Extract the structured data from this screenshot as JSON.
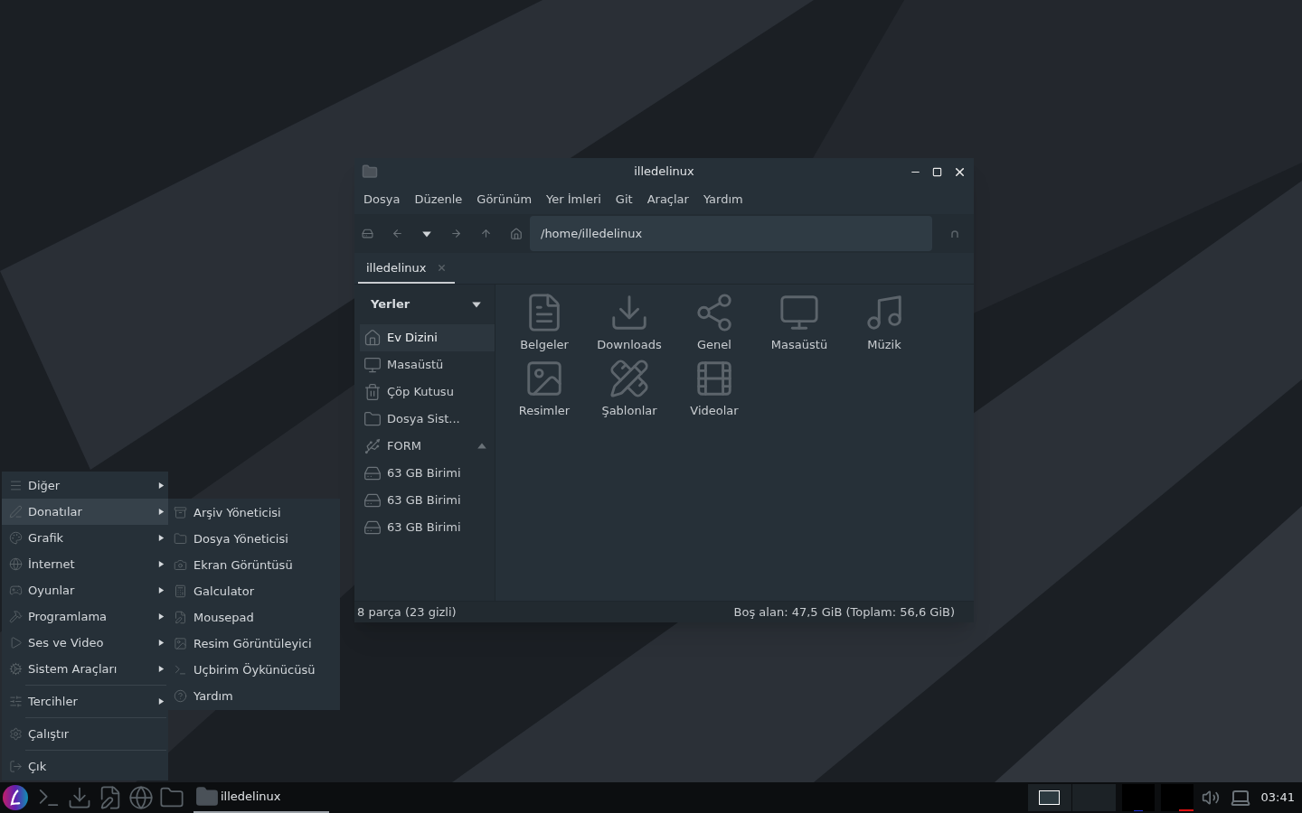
{
  "window": {
    "title": "illedelinux",
    "menu": [
      "Dosya",
      "Düzenle",
      "Görünüm",
      "Yer İmleri",
      "Git",
      "Araçlar",
      "Yardım"
    ],
    "path": "/home/illedelinux",
    "tabs": [
      {
        "label": "illedelinux",
        "selected": true
      }
    ],
    "sidebar": {
      "header": "Yerler",
      "expanded": true,
      "items": [
        {
          "label": "Ev Dizini",
          "kind": "home",
          "selected": true,
          "ejectable": false
        },
        {
          "label": "Masaüstü",
          "kind": "desktop",
          "selected": false,
          "ejectable": false
        },
        {
          "label": "Çöp Kutusu",
          "kind": "trash",
          "selected": false,
          "ejectable": false
        },
        {
          "label": "Dosya Sist...",
          "kind": "folder",
          "selected": false,
          "ejectable": false
        },
        {
          "label": "FORM",
          "kind": "usb",
          "selected": false,
          "ejectable": true
        },
        {
          "label": "63 GB Birimi",
          "kind": "drive",
          "selected": false,
          "ejectable": false
        },
        {
          "label": "63 GB Birimi",
          "kind": "drive",
          "selected": false,
          "ejectable": false
        },
        {
          "label": "63 GB Birimi",
          "kind": "drive",
          "selected": false,
          "ejectable": false
        }
      ]
    },
    "files": [
      {
        "label": "Belgeler",
        "kind": "documents"
      },
      {
        "label": "Downloads",
        "kind": "downloads"
      },
      {
        "label": "Genel",
        "kind": "share"
      },
      {
        "label": "Masaüstü",
        "kind": "desktop"
      },
      {
        "label": "Müzik",
        "kind": "music"
      },
      {
        "label": "Resimler",
        "kind": "pictures"
      },
      {
        "label": "Şablonlar",
        "kind": "templates"
      },
      {
        "label": "Videolar",
        "kind": "videos"
      }
    ],
    "status": {
      "left": "8 parça (23 gizli)",
      "right": "Boş alan: 47,5 GiB (Toplam: 56,6 GiB)"
    }
  },
  "start_menu": {
    "items": [
      {
        "label": "Diğer",
        "kind": "other",
        "submenu": true,
        "selected": false,
        "separator_before": false
      },
      {
        "label": "Donatılar",
        "kind": "accessories",
        "submenu": true,
        "selected": true,
        "separator_before": false
      },
      {
        "label": "Grafik",
        "kind": "graphics",
        "submenu": true,
        "selected": false,
        "separator_before": false
      },
      {
        "label": "İnternet",
        "kind": "internet",
        "submenu": true,
        "selected": false,
        "separator_before": false
      },
      {
        "label": "Oyunlar",
        "kind": "games",
        "submenu": true,
        "selected": false,
        "separator_before": false
      },
      {
        "label": "Programlama",
        "kind": "programming",
        "submenu": true,
        "selected": false,
        "separator_before": false
      },
      {
        "label": "Ses ve Video",
        "kind": "media",
        "submenu": true,
        "selected": false,
        "separator_before": false
      },
      {
        "label": "Sistem Araçları",
        "kind": "system",
        "submenu": true,
        "selected": false,
        "separator_before": false
      },
      {
        "label": "Tercihler",
        "kind": "settings",
        "submenu": true,
        "selected": false,
        "separator_before": true
      },
      {
        "label": "Çalıştır",
        "kind": "run",
        "submenu": false,
        "selected": false,
        "separator_before": true
      },
      {
        "label": "Çık",
        "kind": "logout",
        "submenu": false,
        "selected": false,
        "separator_before": true
      }
    ],
    "submenu": [
      {
        "label": "Arşiv Yöneticisi",
        "kind": "archive"
      },
      {
        "label": "Dosya Yöneticisi",
        "kind": "folder"
      },
      {
        "label": "Ekran Görüntüsü",
        "kind": "screenshot"
      },
      {
        "label": "Galculator",
        "kind": "calculator"
      },
      {
        "label": "Mousepad",
        "kind": "editor"
      },
      {
        "label": "Resim Görüntüleyici",
        "kind": "image"
      },
      {
        "label": "Uçbirim Öykünücüsü",
        "kind": "terminal"
      },
      {
        "label": "Yardım",
        "kind": "help"
      }
    ]
  },
  "taskbar": {
    "launchers": [
      {
        "kind": "terminal"
      },
      {
        "kind": "download"
      },
      {
        "kind": "editor"
      },
      {
        "kind": "browser"
      },
      {
        "kind": "files"
      }
    ],
    "tasks": [
      {
        "label": "illedelinux",
        "selected": true
      }
    ],
    "workspaces": [
      {
        "selected": true
      },
      {
        "selected": false
      }
    ],
    "clock": "03:41"
  }
}
